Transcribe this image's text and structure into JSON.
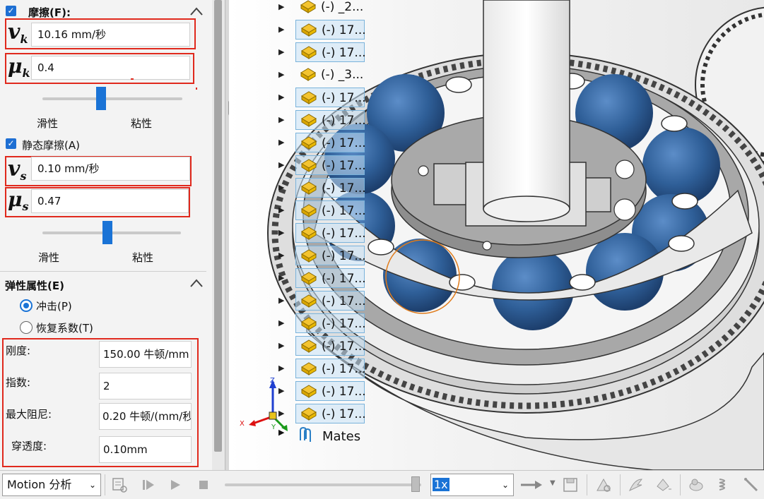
{
  "friction": {
    "section_label": "摩擦(F):",
    "vk_symbol": "v",
    "vk_sub": "k",
    "vk_value": "10.16 mm/秒",
    "muk_symbol": "μ",
    "muk_sub": "k",
    "muk_value": "0.4",
    "slider_left_label": "滑性",
    "slider_right_label": "粘性",
    "kinetic_slider_level": 0.42
  },
  "static_friction": {
    "checkbox_label": "静态摩擦(A)",
    "vs_symbol": "v",
    "vs_sub": "s",
    "vs_value": "0.10 mm/秒",
    "mus_symbol": "μ",
    "mus_sub": "s",
    "mus_value": "0.47",
    "slider_left_label": "滑性",
    "slider_right_label": "粘性",
    "static_slider_level": 0.47
  },
  "elastic": {
    "section_label": "弹性属性(E)",
    "radio_impact": "冲击(P)",
    "radio_restitution": "恢复系数(T)",
    "stiffness_label": "刚度:",
    "stiffness_value": "150.00 牛顿/mm",
    "exponent_label": "指数:",
    "exponent_value": "2",
    "max_damping_label": "最大阻尼:",
    "max_damping_value": "0.20 牛顿/(mm/秒",
    "penetration_label": "穿透度:",
    "penetration_value": "0.10mm"
  },
  "tree": {
    "items": [
      {
        "label": "(-) _2...",
        "selected": false
      },
      {
        "label": "(-) 17...",
        "selected": true
      },
      {
        "label": "(-) 17...",
        "selected": true
      },
      {
        "label": "(-) _3...",
        "selected": false
      },
      {
        "label": "(-) 17...",
        "selected": true
      },
      {
        "label": "(-) 17...",
        "selected": true
      },
      {
        "label": "(-) 17...",
        "selected": true
      },
      {
        "label": "(-) 17...",
        "selected": true
      },
      {
        "label": "(-) 17...",
        "selected": true
      },
      {
        "label": "(-) 17...",
        "selected": true
      },
      {
        "label": "(-) 17...",
        "selected": true
      },
      {
        "label": "(-) 17...",
        "selected": true
      },
      {
        "label": "(-) 17...",
        "selected": true
      },
      {
        "label": "(-) 17...",
        "selected": true
      },
      {
        "label": "(-) 17...",
        "selected": true
      },
      {
        "label": "(-) 17...",
        "selected": true
      },
      {
        "label": "(-) 17...",
        "selected": true
      },
      {
        "label": "(-) 17...",
        "selected": true
      },
      {
        "label": "(-) 17...",
        "selected": true
      }
    ],
    "mates_label": "Mates"
  },
  "triad": {
    "x": "X",
    "y": "Y",
    "z": "Z"
  },
  "toolbar": {
    "study_type": "Motion 分析",
    "speed": "1x"
  },
  "colors": {
    "accent": "#1a73d6",
    "highlight_red": "#e0291d",
    "ball_blue": "#2f5f98",
    "hover_orange": "#e07b1a"
  }
}
